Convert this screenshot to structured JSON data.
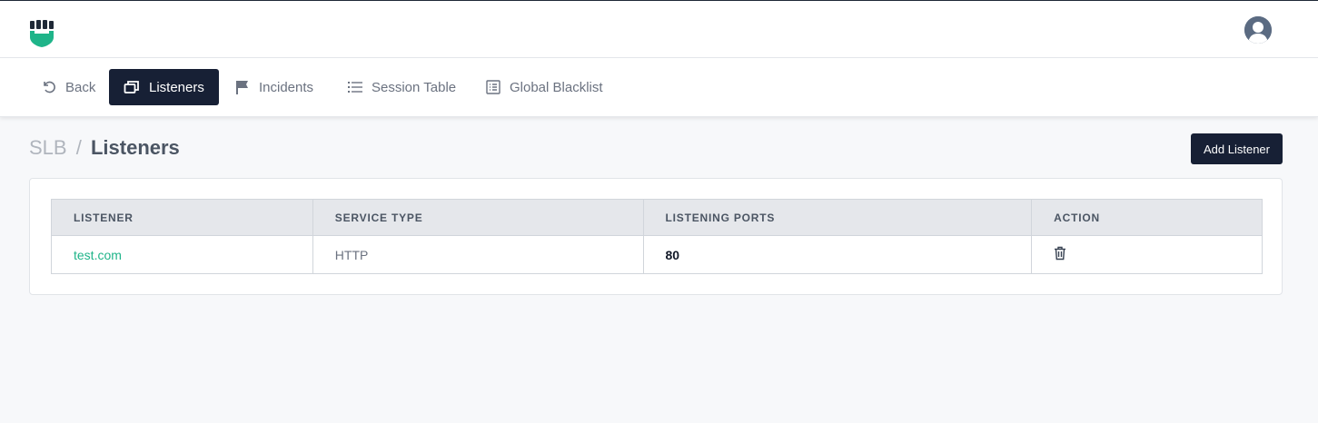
{
  "header": {
    "logo_icon": "fist-shield-logo",
    "avatar_icon": "user-avatar-icon",
    "brand_color": "#1fb489"
  },
  "nav": {
    "items": [
      {
        "label": "Back",
        "icon": "undo-icon"
      },
      {
        "label": "Listeners",
        "icon": "windows-icon",
        "active": true
      },
      {
        "label": "Incidents",
        "icon": "flag-icon"
      },
      {
        "label": "Session Table",
        "icon": "list-icon"
      },
      {
        "label": "Global Blacklist",
        "icon": "list-box-icon"
      }
    ]
  },
  "breadcrumb": {
    "parent": "SLB",
    "separator": "/",
    "current": "Listeners"
  },
  "actions": {
    "add_label": "Add Listener"
  },
  "table": {
    "headers": [
      "LISTENER",
      "SERVICE TYPE",
      "LISTENING PORTS",
      "ACTION"
    ],
    "rows": [
      {
        "listener": "test.com",
        "service_type": "HTTP",
        "ports": "80",
        "action_icon": "trash-icon"
      }
    ]
  },
  "colors": {
    "primary_dark": "#172035",
    "link_green": "#1fb489"
  }
}
